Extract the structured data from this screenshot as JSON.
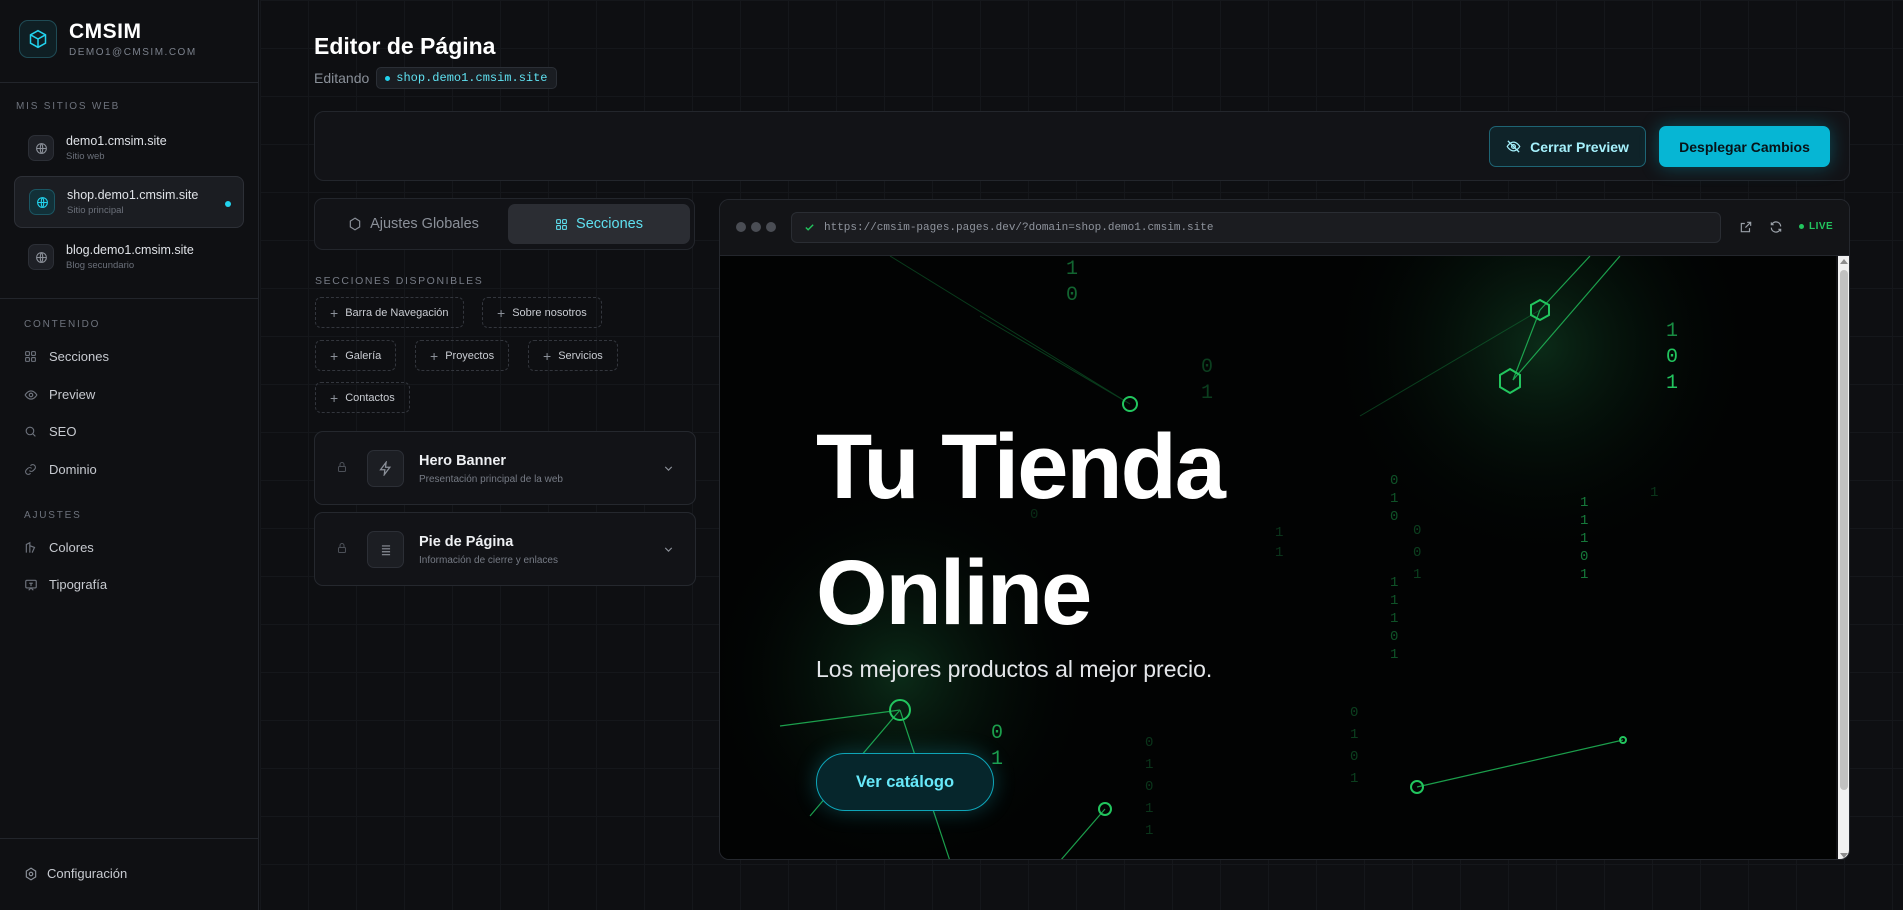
{
  "brand": {
    "name": "CMSIM",
    "email": "DEMO1@CMSIM.COM",
    "logo_icon": "cube-icon"
  },
  "sidebar": {
    "sites_label": "MIS SITIOS WEB",
    "sites": [
      {
        "name": "demo1.cmsim.site",
        "sub": "Sitio web",
        "icon": "globe-icon"
      },
      {
        "name": "shop.demo1.cmsim.site",
        "sub": "Sitio principal",
        "icon": "globe-icon"
      },
      {
        "name": "blog.demo1.cmsim.site",
        "sub": "Blog secundario",
        "icon": "globe-icon"
      }
    ],
    "content_label": "CONTENIDO",
    "content": [
      {
        "label": "Secciones",
        "icon": "grid-icon"
      },
      {
        "label": "Preview",
        "icon": "eye-icon"
      },
      {
        "label": "SEO",
        "icon": "search-icon"
      },
      {
        "label": "Dominio",
        "icon": "link-icon"
      }
    ],
    "settings_label": "AJUSTES",
    "settings": [
      {
        "label": "Colores",
        "icon": "palette-icon"
      },
      {
        "label": "Tipografía",
        "icon": "type-icon"
      }
    ],
    "config_label": "Configuración"
  },
  "header": {
    "title": "Editor de Página",
    "editing_label": "Editando",
    "domain": "shop.demo1.cmsim.site"
  },
  "toolbar": {
    "close_preview": "Cerrar Preview",
    "deploy": "Desplegar Cambios"
  },
  "tabs": {
    "global": "Ajustes Globales",
    "sections": "Secciones"
  },
  "available": {
    "label": "SECCIONES DISPONIBLES",
    "items": [
      "Barra de Navegación",
      "Sobre nosotros",
      "Galería",
      "Proyectos",
      "Servicios",
      "Contactos"
    ]
  },
  "cards": [
    {
      "title": "Hero Banner",
      "sub": "Presentación principal de la web",
      "icon": "bolt-icon"
    },
    {
      "title": "Pie de Página",
      "sub": "Información de cierre y enlaces",
      "icon": "lines-icon"
    }
  ],
  "browser": {
    "url": "https://cmsim-pages.pages.dev/?domain=shop.demo1.cmsim.site",
    "live": "LIVE"
  },
  "preview": {
    "hero_line1": "Tu Tienda",
    "hero_line2": "Online",
    "subtitle": "Los mejores productos al mejor precio.",
    "cta": "Ver catálogo"
  },
  "colors": {
    "accent": "#22d3ee",
    "live": "#22c55e",
    "background": "#0d0e11"
  }
}
